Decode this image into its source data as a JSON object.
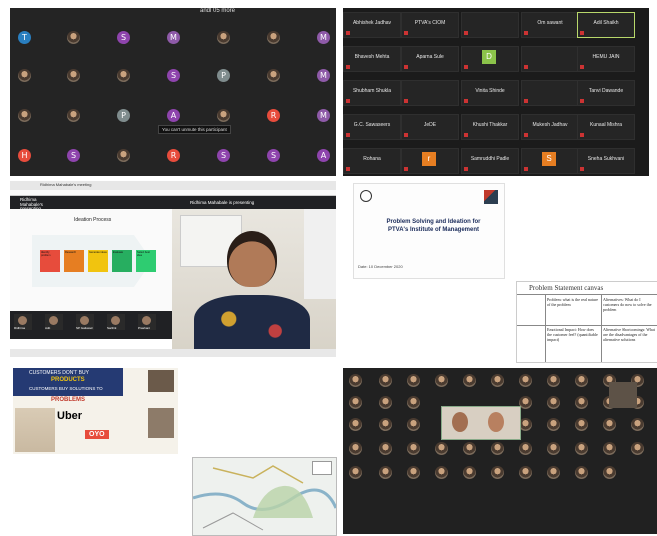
{
  "panel1": {
    "rows": [
      [
        "T",
        "photo",
        "S",
        "M",
        "photo",
        "photo",
        "M"
      ],
      [
        "photo",
        "photo",
        "photo",
        "S",
        "P",
        "photo",
        "M"
      ],
      [
        "photo",
        "photo",
        "P",
        "A",
        "photo",
        "R",
        "M"
      ],
      [
        "H",
        "S",
        "photo",
        "R",
        "S",
        "S",
        "A"
      ]
    ],
    "colors": {
      "T": "#2a7fc0",
      "S": "#8e44ad",
      "M": "#8e5aa8",
      "P": "#7f8c8d",
      "A": "#8e44ad",
      "R": "#e74c3c",
      "H": "#e74c3c"
    },
    "tooltip": "You can't unmute this participant",
    "header": "andl 05 more"
  },
  "panel2": {
    "tiles": [
      {
        "name": "Abhishek Jadhav"
      },
      {
        "name": "PTVA's CIOM"
      },
      {
        "name": ""
      },
      {
        "name": "Om sawant"
      },
      {
        "name": "Adil Shaikh"
      },
      {
        "name": "Bhavesh Mehta"
      },
      {
        "name": "Aparna Sule"
      },
      {
        "name": "D"
      },
      {
        "name": ""
      },
      {
        "name": "HEMU JAIN"
      },
      {
        "name": "Shubham Shukla"
      },
      {
        "name": ""
      },
      {
        "name": "Vinita Shinde"
      },
      {
        "name": ""
      },
      {
        "name": "Tanvi Dawande"
      },
      {
        "name": "G.C. Sawaseers"
      },
      {
        "name": "JeDE"
      },
      {
        "name": "Khushi Thakkar"
      },
      {
        "name": "Mukesh Jadhav"
      },
      {
        "name": "Kunaal Mishra"
      },
      {
        "name": "Rohana"
      },
      {
        "name": "r"
      },
      {
        "name": "Samruddhi Padle"
      },
      {
        "name": "S"
      },
      {
        "name": "Sneha Sukhvani"
      }
    ]
  },
  "panel3": {
    "tab1": "Ridhima Mahabale's meeting",
    "presenter1": "Ridhima Mahabale's presenting",
    "presenter2": "Ridhima Mahabale is presenting",
    "slide_title": "Ideation Process",
    "steps": [
      "Identify problem",
      "Research",
      "Generate ideas",
      "Evaluate",
      "Select best idea"
    ],
    "step_colors": [
      "#e74c3c",
      "#e67e22",
      "#f1c40f",
      "#27ae60",
      "#2ecc71"
    ],
    "participants": [
      "Ridhima",
      "Adit",
      "SP Gaikwad",
      "Sarthik",
      "Prashant"
    ]
  },
  "panel4": {
    "title": "Problem Solving and Ideation for PTVA's Institute of Management",
    "date": "Date: 10 December 2020"
  },
  "panel5": {
    "header": "Problem Statement canvas",
    "cells": [
      "Problem: what is the real nature of the problem",
      "Alternatives: What do I customers do now to solve the problem",
      "Emotional Impact: How does the customer feel? (quantifiable impact)",
      "Alternative Shortcomings: What are the disadvantages of the alternative solutions"
    ]
  },
  "panel6": {
    "line1": "CUSTOMERS DON'T BUY",
    "line2": "PRODUCTS",
    "line3": "CUSTOMERS BUY SOLUTIONS TO",
    "line4": "PROBLEMS",
    "brand1": "Uber",
    "brand2": "OYO"
  },
  "panel7": {
    "label": "Map"
  },
  "panel8": {
    "count": 48
  }
}
